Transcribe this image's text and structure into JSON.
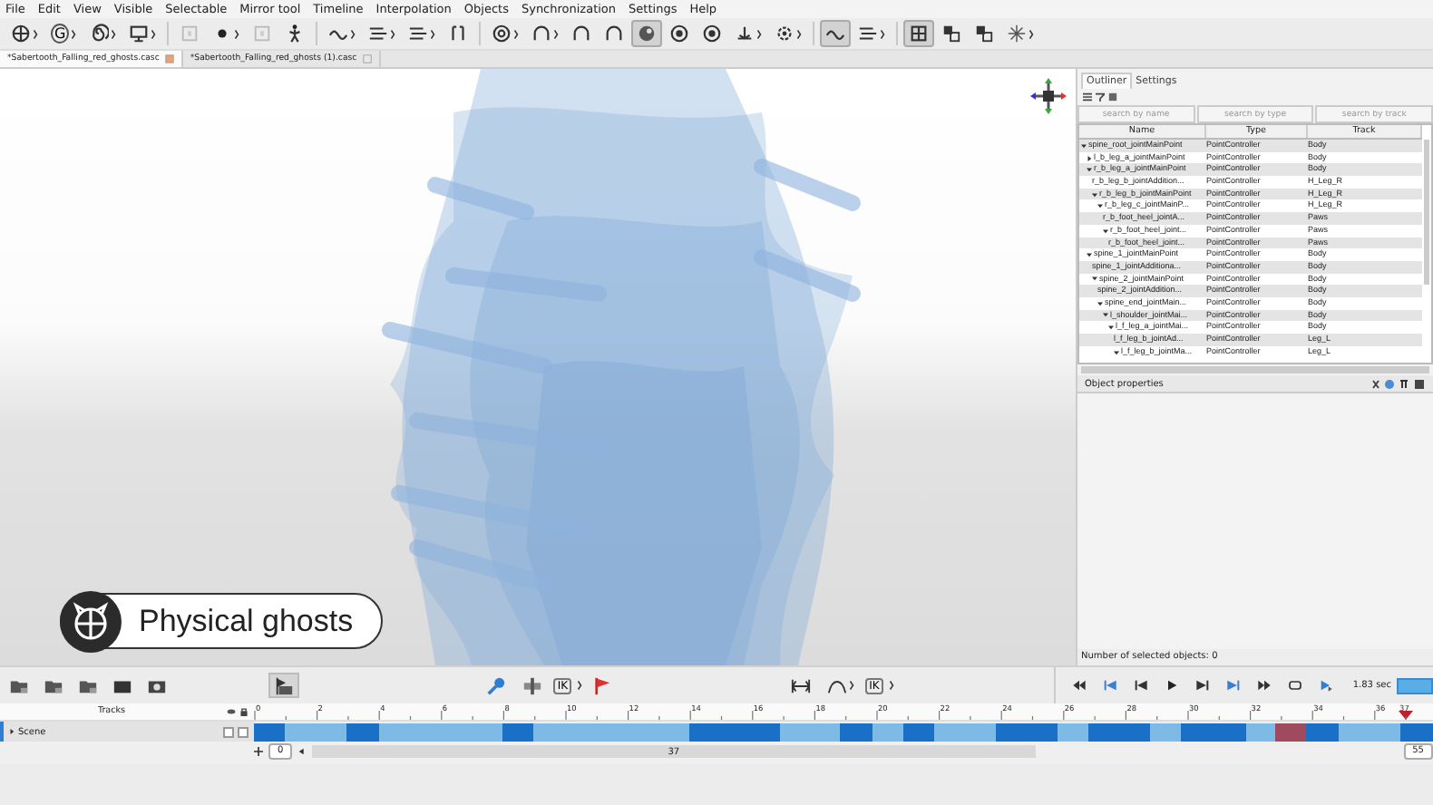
{
  "menu": [
    "File",
    "Edit",
    "View",
    "Visible",
    "Selectable",
    "Mirror tool",
    "Timeline",
    "Interpolation",
    "Objects",
    "Synchronization",
    "Settings",
    "Help"
  ],
  "toolbar": [
    {
      "kind": "globe",
      "dropdown": true,
      "pressed": false
    },
    {
      "kind": "letter",
      "label": "G",
      "dropdown": true,
      "pressed": false
    },
    {
      "kind": "spiral",
      "dropdown": true,
      "pressed": false
    },
    {
      "kind": "monitor",
      "dropdown": true,
      "pressed": false
    },
    {
      "kind": "frame",
      "dropdown": false,
      "pressed": false
    },
    {
      "kind": "dot",
      "dropdown": true,
      "pressed": false
    },
    {
      "kind": "frame",
      "dropdown": false,
      "pressed": false
    },
    {
      "kind": "figure",
      "dropdown": false,
      "pressed": false
    },
    {
      "kind": "wave",
      "dropdown": true,
      "pressed": false
    },
    {
      "kind": "lines",
      "dropdown": true,
      "pressed": false
    },
    {
      "kind": "lines",
      "dropdown": true,
      "pressed": false
    },
    {
      "kind": "bracket",
      "dropdown": false,
      "pressed": false
    },
    {
      "kind": "target",
      "dropdown": true,
      "pressed": false
    },
    {
      "kind": "arch",
      "dropdown": true,
      "pressed": false
    },
    {
      "kind": "arch",
      "dropdown": false,
      "pressed": false
    },
    {
      "kind": "arch",
      "dropdown": false,
      "pressed": false
    },
    {
      "kind": "ball",
      "dropdown": false,
      "pressed": true
    },
    {
      "kind": "ring",
      "dropdown": false,
      "pressed": false
    },
    {
      "kind": "ring",
      "dropdown": false,
      "pressed": false
    },
    {
      "kind": "anchor",
      "dropdown": true,
      "pressed": false
    },
    {
      "kind": "gear",
      "dropdown": true,
      "pressed": false
    },
    {
      "kind": "wave",
      "dropdown": false,
      "pressed": true
    },
    {
      "kind": "lines",
      "dropdown": true,
      "pressed": false
    },
    {
      "kind": "grid",
      "dropdown": false,
      "pressed": true
    },
    {
      "kind": "checker",
      "dropdown": false,
      "pressed": false
    },
    {
      "kind": "checker",
      "dropdown": false,
      "pressed": false
    },
    {
      "kind": "sparkle",
      "dropdown": true,
      "pressed": false
    }
  ],
  "document_tabs": [
    {
      "title": "*Sabertooth_Falling_red_ghosts.casc",
      "selected": true
    },
    {
      "title": "*Sabertooth_Falling_red_ghosts (1).casc",
      "selected": false
    }
  ],
  "viewport": {
    "caption": "Physical ghosts"
  },
  "outliner": {
    "tabs": [
      {
        "label": "Outliner",
        "selected": true
      },
      {
        "label": "Settings",
        "selected": false
      }
    ],
    "search": [
      {
        "placeholder": "search by name"
      },
      {
        "placeholder": "search by type"
      },
      {
        "placeholder": "search by track"
      }
    ],
    "columns": [
      "Name",
      "Type",
      "Track"
    ],
    "rows": [
      {
        "name": "spine_root_jointMainPoint",
        "type": "PointController",
        "track": "Body",
        "expanded": true,
        "children": [
          {
            "name": "l_b_leg_a_jointMainPoint",
            "type": "PointController",
            "track": "Body",
            "expanded": false
          },
          {
            "name": "r_b_leg_a_jointMainPoint",
            "type": "PointController",
            "track": "Body",
            "expanded": true,
            "children": [
              {
                "name": "r_b_leg_b_jointAddition...",
                "type": "PointController",
                "track": "H_Leg_R"
              },
              {
                "name": "r_b_leg_b_jointMainPoint",
                "type": "PointController",
                "track": "H_Leg_R",
                "expanded": true,
                "children": [
                  {
                    "name": "r_b_leg_c_jointMainP...",
                    "type": "PointController",
                    "track": "H_Leg_R",
                    "expanded": true,
                    "children": [
                      {
                        "name": "r_b_foot_heel_jointA...",
                        "type": "PointController",
                        "track": "Paws"
                      },
                      {
                        "name": "r_b_foot_heel_joint...",
                        "type": "PointController",
                        "track": "Paws",
                        "expanded": true,
                        "children": [
                          {
                            "name": "r_b_foot_heel_joint...",
                            "type": "PointController",
                            "track": "Paws"
                          }
                        ]
                      }
                    ]
                  }
                ]
              }
            ]
          },
          {
            "name": "spine_1_jointMainPoint",
            "type": "PointController",
            "track": "Body",
            "expanded": true,
            "children": [
              {
                "name": "spine_1_jointAdditiona...",
                "type": "PointController",
                "track": "Body"
              },
              {
                "name": "spine_2_jointMainPoint",
                "type": "PointController",
                "track": "Body",
                "expanded": true,
                "children": [
                  {
                    "name": "spine_2_jointAddition...",
                    "type": "PointController",
                    "track": "Body"
                  },
                  {
                    "name": "spine_end_jointMain...",
                    "type": "PointController",
                    "track": "Body",
                    "expanded": true,
                    "children": [
                      {
                        "name": "l_shoulder_jointMai...",
                        "type": "PointController",
                        "track": "Body",
                        "expanded": true,
                        "children": [
                          {
                            "name": "l_f_leg_a_jointMai...",
                            "type": "PointController",
                            "track": "Body",
                            "expanded": true,
                            "children": [
                              {
                                "name": "l_f_leg_b_jointAd...",
                                "type": "PointController",
                                "track": "Leg_L"
                              },
                              {
                                "name": "l_f_leg_b_jointMa...",
                                "type": "PointController",
                                "track": "Leg_L",
                                "expanded": true
                              }
                            ]
                          }
                        ]
                      }
                    ]
                  }
                ]
              }
            ]
          }
        ]
      }
    ],
    "properties_title": "Object properties",
    "status": "Number of selected objects: 0"
  },
  "bottom_bar": {
    "ik_labels": [
      "IK",
      "IK"
    ],
    "speed": {
      "level": 1
    }
  },
  "timeline": {
    "tracks_label": "Tracks",
    "scene": "Scene",
    "scene_visible": false,
    "scene_locked": false,
    "ticks": [
      "0",
      "2",
      "4",
      "6",
      "8",
      "10",
      "12",
      "14",
      "16",
      "18",
      "20",
      "22",
      "24",
      "26",
      "28",
      "30",
      "32",
      "34",
      "36"
    ],
    "current": "37",
    "start_field": "0",
    "end_field": "37",
    "right_field": "55",
    "duration": "1.83 sec"
  }
}
